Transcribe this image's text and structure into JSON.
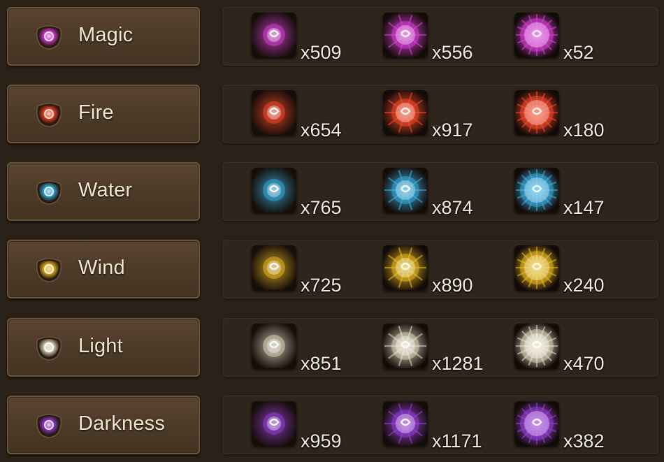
{
  "colors": {
    "background": "#2a2118",
    "plate": "#4e3b28",
    "panel": "#2e251c",
    "text": "#f0e6d2"
  },
  "attributes": [
    {
      "name": "Magic",
      "emblem_icon": "magic-attribute-icon",
      "accent": "#e040e0",
      "essences": [
        {
          "tier": "low",
          "icon": "magic-essence-low-icon",
          "count": "x509"
        },
        {
          "tier": "mid",
          "icon": "magic-essence-mid-icon",
          "count": "x556"
        },
        {
          "tier": "high",
          "icon": "magic-essence-high-icon",
          "count": "x52"
        }
      ]
    },
    {
      "name": "Fire",
      "emblem_icon": "fire-attribute-icon",
      "accent": "#ff4a2a",
      "essences": [
        {
          "tier": "low",
          "icon": "fire-essence-low-icon",
          "count": "x654"
        },
        {
          "tier": "mid",
          "icon": "fire-essence-mid-icon",
          "count": "x917"
        },
        {
          "tier": "high",
          "icon": "fire-essence-high-icon",
          "count": "x180"
        }
      ]
    },
    {
      "name": "Water",
      "emblem_icon": "water-attribute-icon",
      "accent": "#38b4e8",
      "essences": [
        {
          "tier": "low",
          "icon": "water-essence-low-icon",
          "count": "x765"
        },
        {
          "tier": "mid",
          "icon": "water-essence-mid-icon",
          "count": "x874"
        },
        {
          "tier": "high",
          "icon": "water-essence-high-icon",
          "count": "x147"
        }
      ]
    },
    {
      "name": "Wind",
      "emblem_icon": "wind-attribute-icon",
      "accent": "#f0c020",
      "essences": [
        {
          "tier": "low",
          "icon": "wind-essence-low-icon",
          "count": "x725"
        },
        {
          "tier": "mid",
          "icon": "wind-essence-mid-icon",
          "count": "x890"
        },
        {
          "tier": "high",
          "icon": "wind-essence-high-icon",
          "count": "x240"
        }
      ]
    },
    {
      "name": "Light",
      "emblem_icon": "light-attribute-icon",
      "accent": "#e8e0c8",
      "essences": [
        {
          "tier": "low",
          "icon": "light-essence-low-icon",
          "count": "x851"
        },
        {
          "tier": "mid",
          "icon": "light-essence-mid-icon",
          "count": "x1281"
        },
        {
          "tier": "high",
          "icon": "light-essence-high-icon",
          "count": "x470"
        }
      ]
    },
    {
      "name": "Darkness",
      "emblem_icon": "darkness-attribute-icon",
      "accent": "#9b40e0",
      "essences": [
        {
          "tier": "low",
          "icon": "darkness-essence-low-icon",
          "count": "x959"
        },
        {
          "tier": "mid",
          "icon": "darkness-essence-mid-icon",
          "count": "x1171"
        },
        {
          "tier": "high",
          "icon": "darkness-essence-high-icon",
          "count": "x382"
        }
      ]
    }
  ]
}
